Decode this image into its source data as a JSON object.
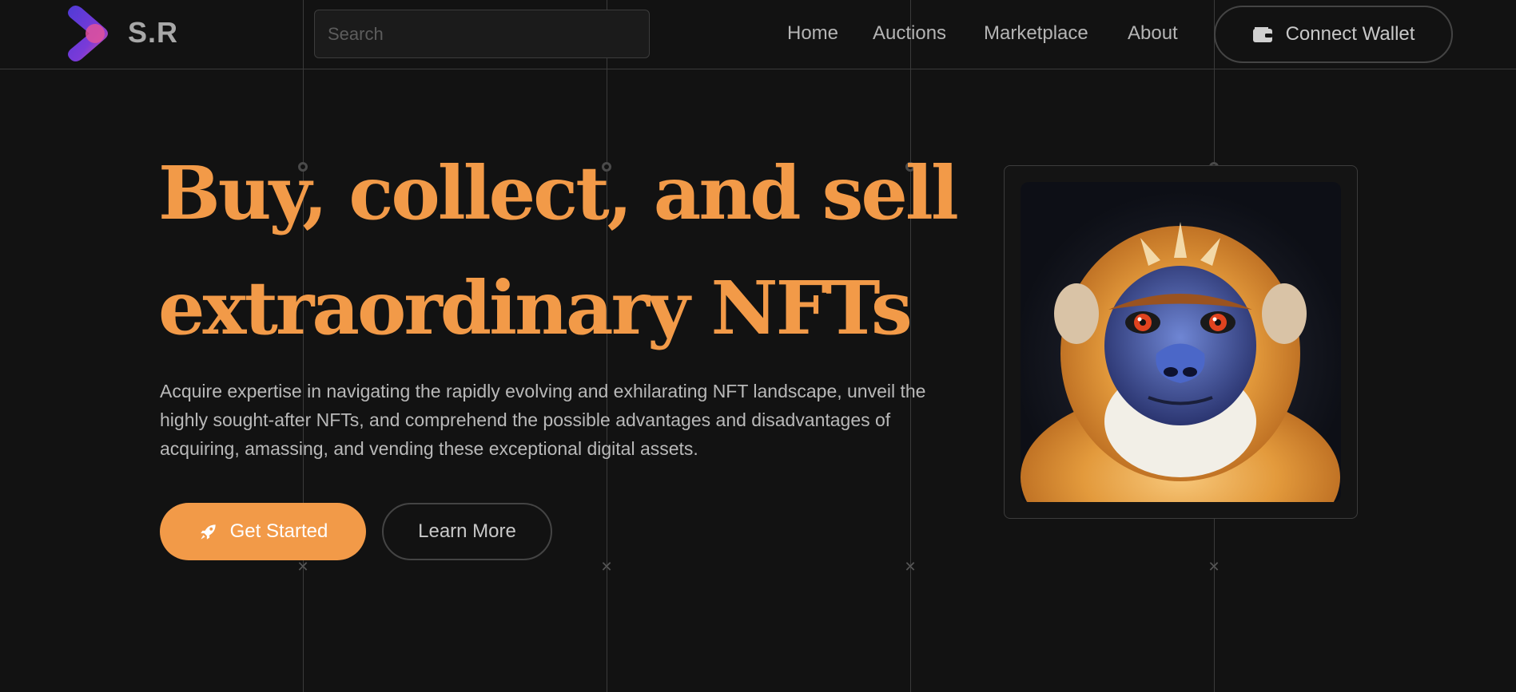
{
  "header": {
    "brand": "S.R",
    "search_placeholder": "Search",
    "nav": [
      "Home",
      "Auctions",
      "Marketplace",
      "About"
    ],
    "wallet_label": "Connect Wallet",
    "wallet_icon": "wallet-icon",
    "logo_icon": "chevron-logo"
  },
  "hero": {
    "title_line1": "Buy, collect, and sell",
    "title_line2": "extraordinary NFTs",
    "description": "Acquire expertise in navigating the rapidly evolving and exhilarating NFT landscape, unveil the highly sought-after NFTs, and comprehend the possible advantages and disadvantages of acquiring, amassing, and vending these exceptional digital assets.",
    "primary_button": "Get Started",
    "primary_icon": "rocket-icon",
    "secondary_button": "Learn More"
  },
  "featured_nft": {
    "subject": "monkey portrait"
  },
  "colors": {
    "background": "#121212",
    "accent": "#f29a48",
    "text": "#b9b9b9",
    "logo_gradient": [
      "#4f3bd6",
      "#e0529c"
    ]
  }
}
